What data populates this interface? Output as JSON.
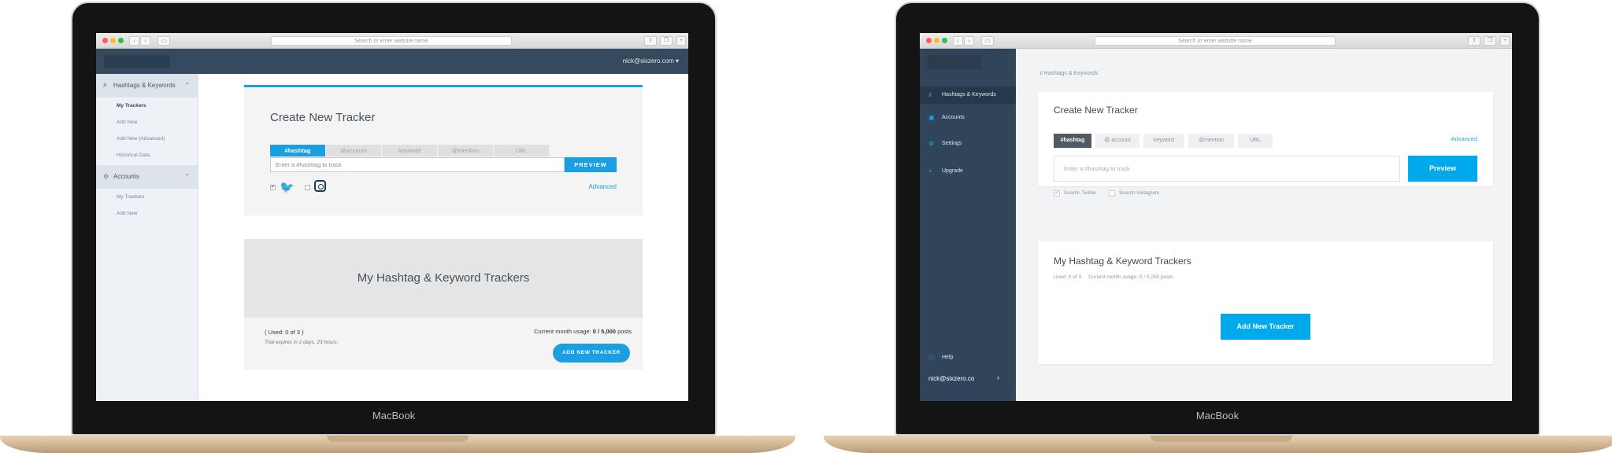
{
  "browser": {
    "address_placeholder": "Search or enter website name"
  },
  "device_label": "MacBook",
  "old": {
    "user_menu": "nick@sixzero.com ▾",
    "sidebar": {
      "sections": [
        {
          "label": "Hashtags & Keywords",
          "icon": "hash-icon",
          "items": [
            "My Trackers",
            "Add New",
            "Add New (Advanced)",
            "Historical Data"
          ]
        },
        {
          "label": "Accounts",
          "icon": "gear-icon",
          "items": [
            "My Trackers",
            "Add New"
          ]
        }
      ]
    },
    "create": {
      "title": "Create New Tracker",
      "tabs": [
        "#hashtag",
        "@account",
        "keyword",
        "@mention",
        "URL"
      ],
      "input_placeholder": "Enter a #hashtag to track",
      "preview_label": "PREVIEW",
      "advanced_label": "Advanced"
    },
    "trackers": {
      "title": "My Hashtag & Keyword Trackers",
      "used": "( Used: 0 of 3 )",
      "trial": "Trial expires in 2 days, 23 hours.",
      "usage_prefix": "Current month usage:",
      "usage_value": "0 / 5,000",
      "usage_suffix": "posts",
      "add_label": "ADD NEW TRACKER"
    }
  },
  "new": {
    "sidebar": {
      "items": [
        "Hashtags & Keywords",
        "Accounts",
        "Settings",
        "Upgrade"
      ],
      "help": "Help",
      "user": "nick@sixzero.co"
    },
    "breadcrumb": "Hashtags & Keywords",
    "create": {
      "title": "Create New Tracker",
      "tabs": [
        "#hashtag",
        "@ account",
        "keyword",
        "@mention",
        "URL"
      ],
      "advanced_label": "Advanced",
      "input_placeholder": "Enter a #hashtag to track",
      "preview_label": "Preview",
      "search_twitter": "Search Twitter",
      "search_instagram": "Search Instagram"
    },
    "trackers": {
      "title": "My Hashtag & Keyword Trackers",
      "used": "Used: 0 of 3",
      "usage": "Current month usage: 0 / 5,000 posts",
      "add_label": "Add New Tracker"
    }
  },
  "colors": {
    "accent_old": "#1b9fe3",
    "accent_new": "#00a9ec",
    "sidebar_new": "#304559",
    "topbar_old": "#354a5f"
  }
}
